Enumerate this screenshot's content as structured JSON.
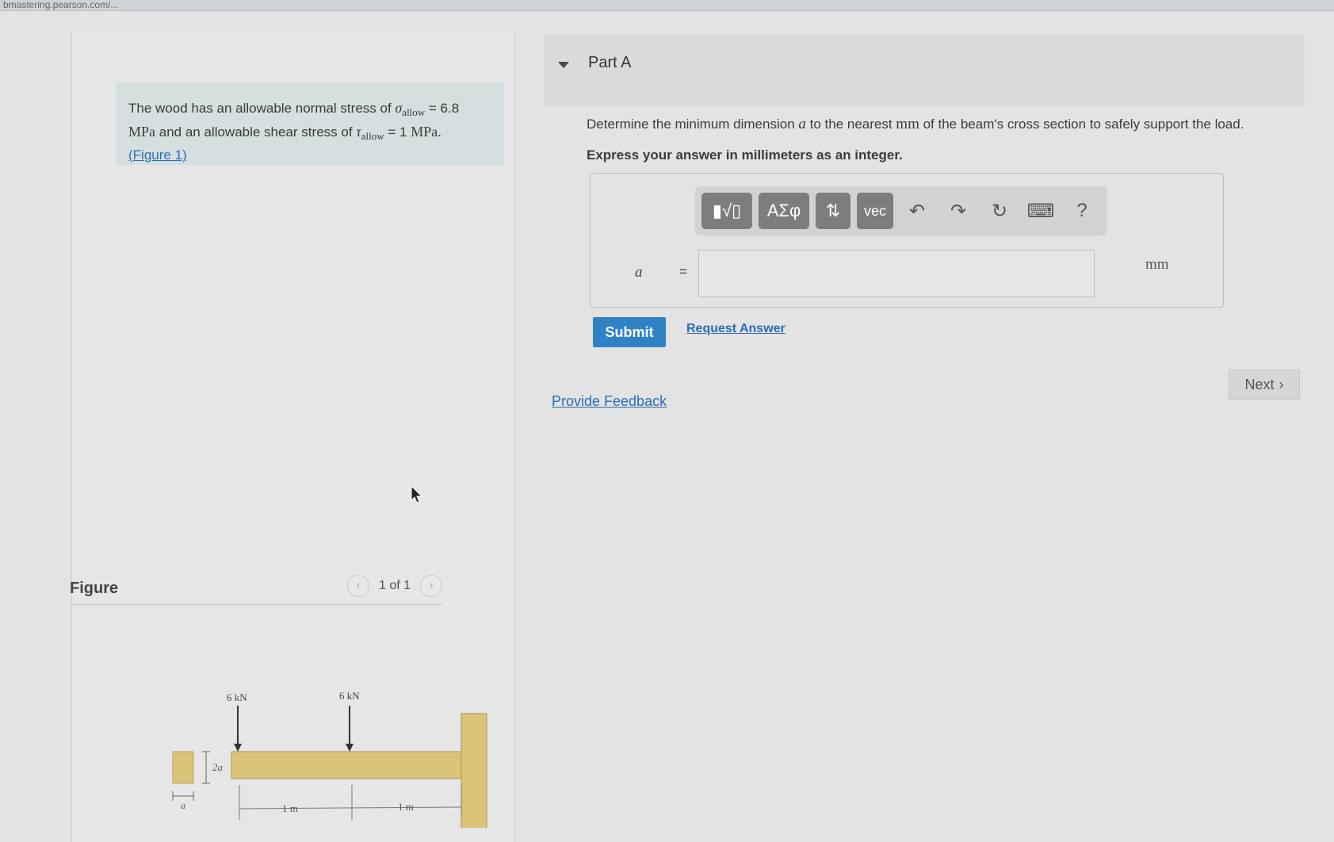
{
  "browser": {
    "url": "bmastering.pearson.com/..."
  },
  "problem": {
    "text_1": "The wood has an allowable normal stress of ",
    "sigma": "σ",
    "sigma_sub": "allow",
    "sigma_value": " = 6.8",
    "unit_mpa": "MPa",
    "text_2": " and an allowable shear stress of ",
    "tau": "τ",
    "tau_sub": "allow",
    "tau_value": " = 1 ",
    "unit_mpa_end": "MPa.",
    "figure_link": "(Figure 1)"
  },
  "figure": {
    "title": "Figure",
    "prev_icon": "chevron-left-icon",
    "next_icon": "chevron-right-icon",
    "count": "1 of 1",
    "load_1": "6 kN",
    "load_2": "6 kN",
    "dim_height": "2a",
    "dim_width": "a",
    "span_1": "1 m",
    "span_2": "1 m"
  },
  "part": {
    "title": "Part A",
    "question_1": "Determine the minimum dimension ",
    "question_var": "a",
    "question_2": " to the nearest ",
    "question_unit": "mm",
    "question_3": " of the beam's cross section to safely support the load.",
    "express": "Express your answer in millimeters as an integer."
  },
  "toolbar": {
    "templates": "▮√▯",
    "greek": "ΑΣφ",
    "arrows": "⇅",
    "vec": "vec",
    "undo_icon": "undo-icon",
    "redo_icon": "redo-icon",
    "reset_icon": "reset-icon",
    "keyboard_icon": "keyboard-icon",
    "help": "?"
  },
  "answer": {
    "variable": "a",
    "equals": "=",
    "value": "",
    "unit": "mm"
  },
  "actions": {
    "submit": "Submit",
    "request_answer": "Request Answer",
    "provide_feedback": "Provide Feedback",
    "next": "Next"
  }
}
